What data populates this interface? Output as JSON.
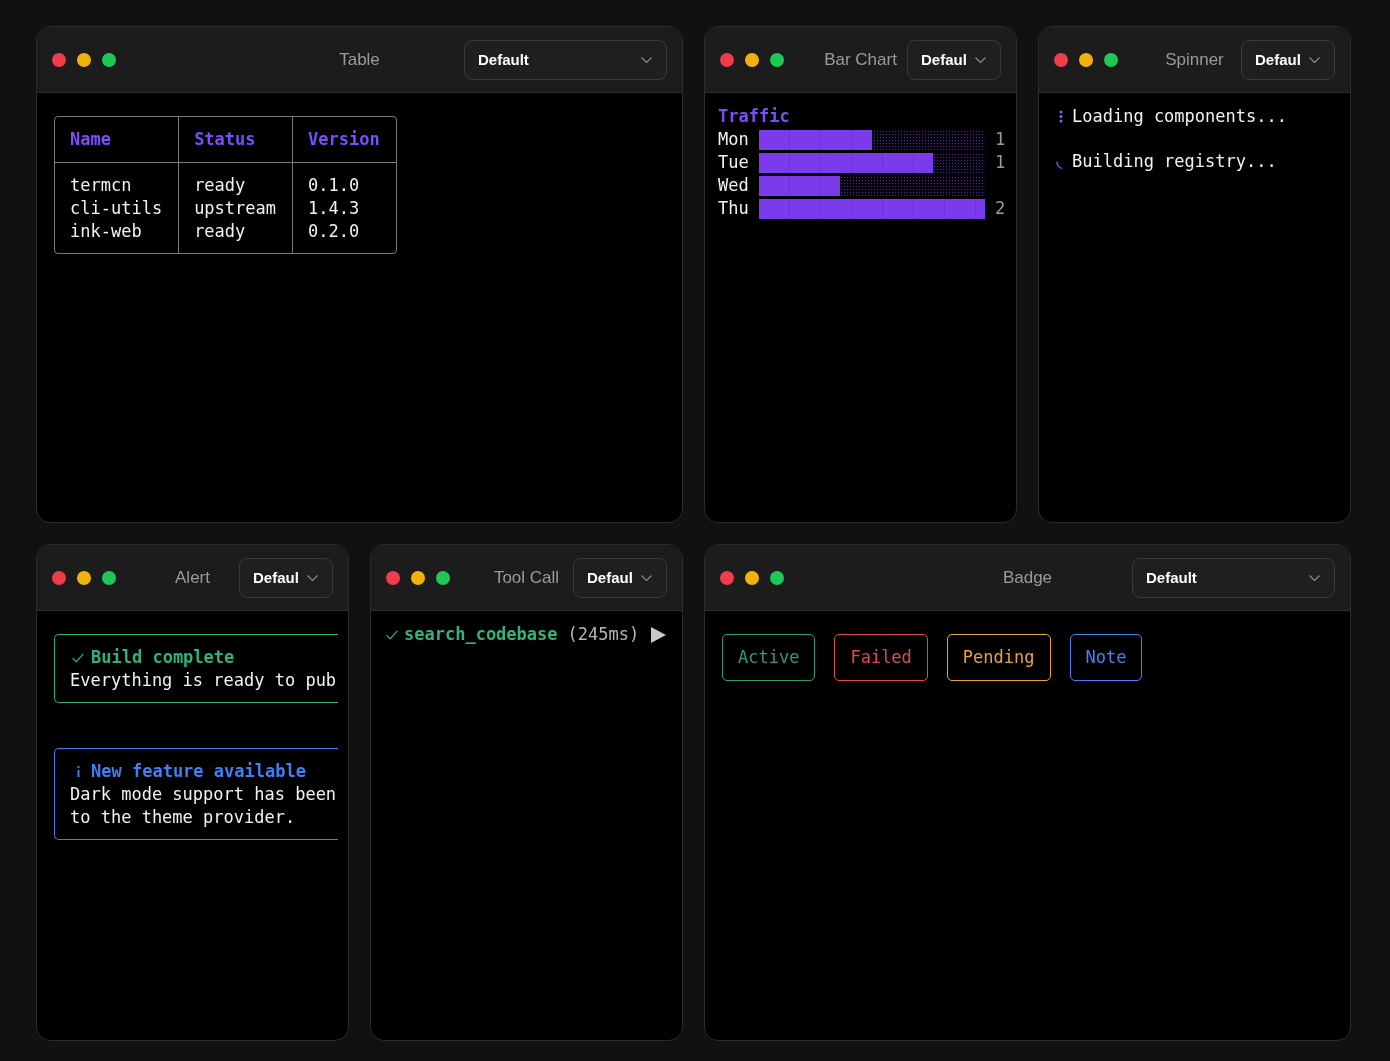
{
  "panels": [
    {
      "kind": "table",
      "title": "Table",
      "dropdown": "Default",
      "table": {
        "columns": [
          "Name",
          "Status",
          "Version"
        ],
        "rows": [
          [
            "termcn",
            "ready",
            "0.1.0"
          ],
          [
            "cli-utils",
            "upstream",
            "1.4.3"
          ],
          [
            "ink-web",
            "ready",
            "0.2.0"
          ]
        ]
      }
    },
    {
      "kind": "bar_chart",
      "title": "Bar Chart",
      "dropdown": "Defaul",
      "chart": {
        "title": "Traffic",
        "bars": [
          {
            "label": "Mon",
            "level": 0.5,
            "reading": "1"
          },
          {
            "label": "Tue",
            "level": 0.77,
            "reading": "1"
          },
          {
            "label": "Wed",
            "level": 0.36
          },
          {
            "label": "Thu",
            "level": 1.0,
            "reading": "2"
          }
        ]
      }
    },
    {
      "kind": "spinner",
      "title": "Spinner",
      "dropdown": "Defaul",
      "spinners": [
        {
          "kind": "dots",
          "label": "Loading components..."
        },
        {
          "kind": "arc",
          "label": "Building registry..."
        }
      ]
    },
    {
      "kind": "alert",
      "title": "Alert",
      "dropdown": "Defaul",
      "alerts": [
        {
          "kind": "success",
          "title": "Build complete",
          "lines": [
            "Everything is ready to pub"
          ]
        },
        {
          "kind": "info",
          "title": "New feature available",
          "lines": [
            "Dark mode support has been",
            "to the theme provider."
          ]
        }
      ]
    },
    {
      "kind": "tool_call",
      "title": "Tool Call",
      "dropdown": "Defaul",
      "tool_call": {
        "succeeded": true,
        "name": "search_codebase",
        "duration": "(245ms)",
        "expanded": false
      }
    },
    {
      "kind": "badge",
      "title": "Badge",
      "dropdown": "Default",
      "badges": [
        {
          "label": "Active",
          "color": "#2f9e6e"
        },
        {
          "label": "Failed",
          "color": "#e04a4d"
        },
        {
          "label": "Pending",
          "color": "#eea33a"
        },
        {
          "label": "Note",
          "color": "#4583f0"
        }
      ]
    }
  ]
}
